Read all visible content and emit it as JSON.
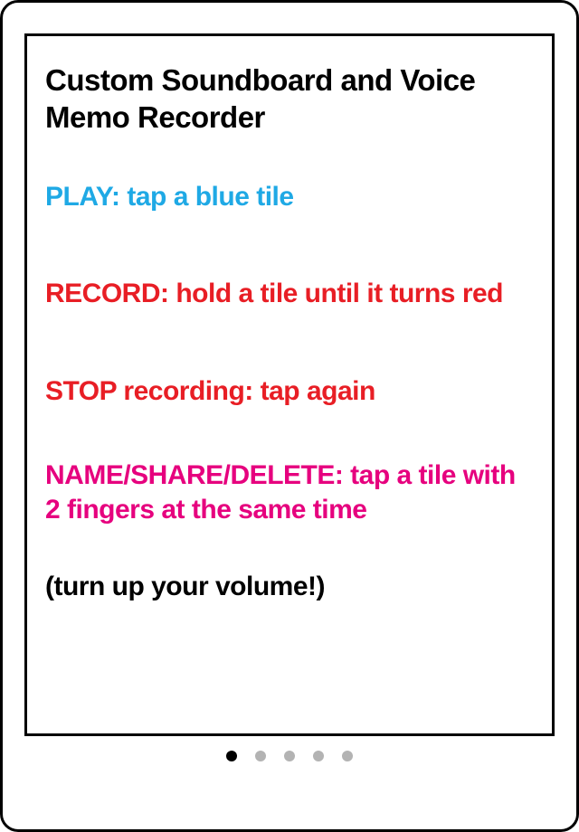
{
  "card": {
    "title": "Custom Soundboard and Voice Memo Recorder",
    "play": "PLAY: tap a blue tile",
    "record": "RECORD: hold a tile until it turns red",
    "stop": "STOP recording: tap again",
    "name_share_delete": "NAME/SHARE/DELETE: tap a tile with 2 fingers at the same time",
    "volume": "(turn up your volume!)"
  },
  "colors": {
    "play": "#1fa9e5",
    "record": "#e81e25",
    "name": "#e6007e"
  },
  "pager": {
    "total": 5,
    "active_index": 0
  }
}
